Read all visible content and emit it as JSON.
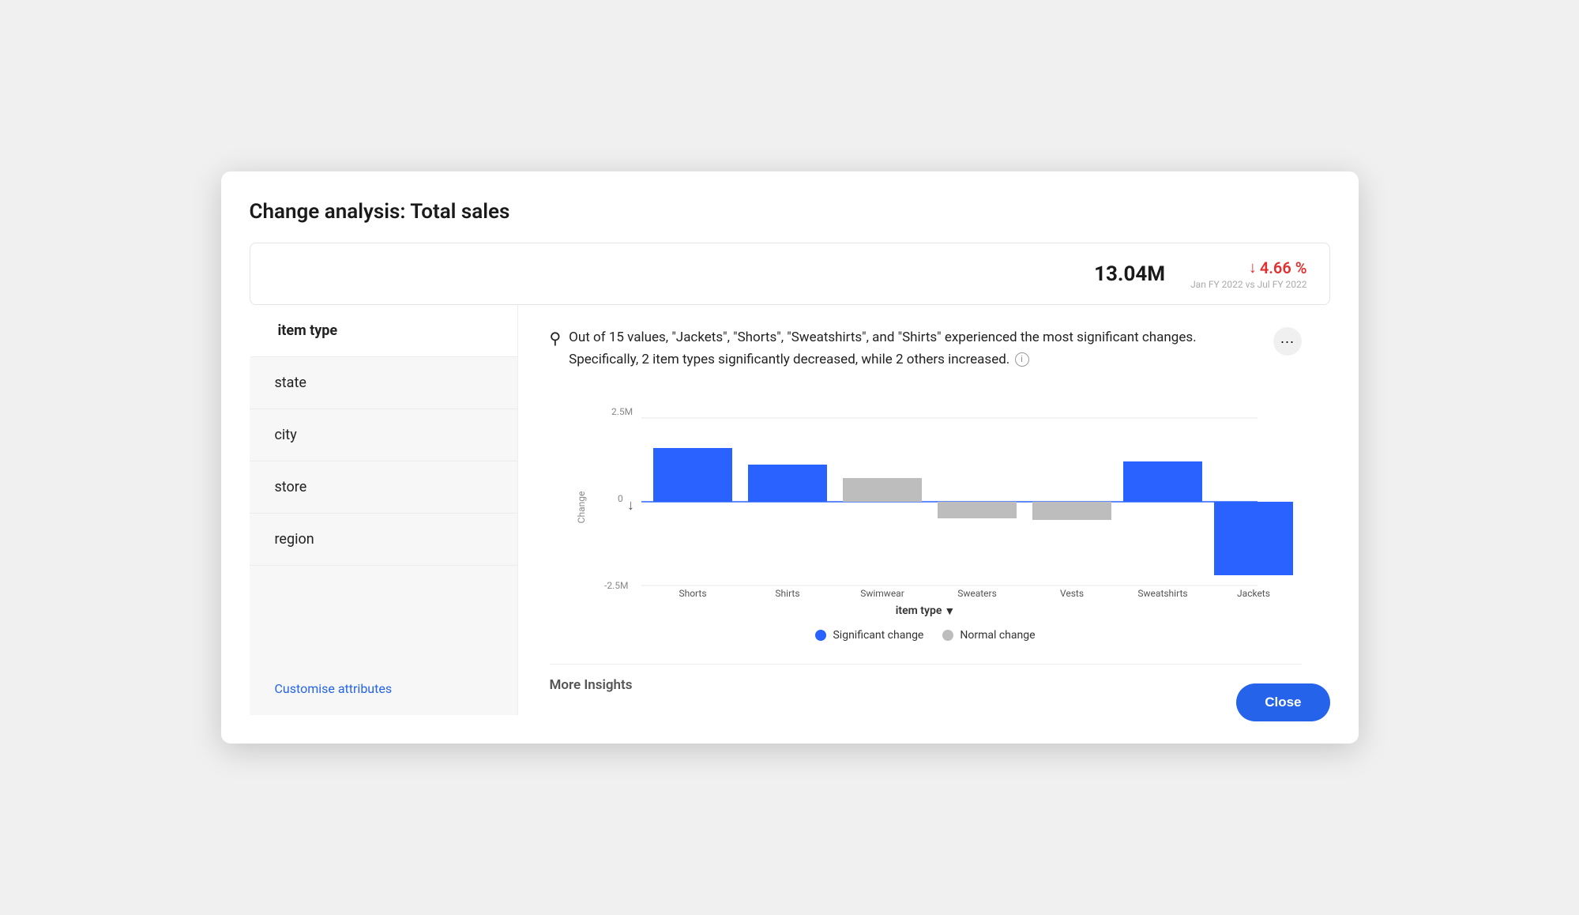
{
  "page": {
    "title": "Change analysis: Total sales"
  },
  "metric": {
    "value": "13.04M",
    "change_pct": "4.66 %",
    "change_direction": "↓",
    "period": "Jan FY 2022 vs Jul FY 2022"
  },
  "sidebar": {
    "items": [
      {
        "id": "item-type",
        "label": "item type",
        "active": true
      },
      {
        "id": "state",
        "label": "state",
        "active": false
      },
      {
        "id": "city",
        "label": "city",
        "active": false
      },
      {
        "id": "store",
        "label": "store",
        "active": false
      },
      {
        "id": "region",
        "label": "region",
        "active": false
      }
    ],
    "customise_label": "Customise attributes"
  },
  "insight": {
    "text_prefix": "Out of 15 values, \"Jackets\", \"Shorts\", \"Sweatshirts\", and \"Shirts\" experienced the most significant changes. Specifically, 2 item types significantly decreased, while 2 others increased.",
    "more_btn_label": "···"
  },
  "chart": {
    "y_labels": [
      "2.5M",
      "0",
      "-2.5M"
    ],
    "x_label": "item type",
    "bars": [
      {
        "label": "Shorts",
        "value": 1.6,
        "significant": true
      },
      {
        "label": "Shirts",
        "value": 1.1,
        "significant": true
      },
      {
        "label": "Swimwear",
        "value": 0.7,
        "significant": false
      },
      {
        "label": "Sweaters",
        "value": -0.5,
        "significant": false
      },
      {
        "label": "Vests",
        "value": -0.55,
        "significant": false
      },
      {
        "label": "Sweatshirts",
        "value": 1.2,
        "significant": true
      },
      {
        "label": "Jackets",
        "value": -2.2,
        "significant": true
      }
    ],
    "y_max": 2.5,
    "y_min": -2.5,
    "legend": [
      {
        "label": "Significant change",
        "color": "#2962ff"
      },
      {
        "label": "Normal change",
        "color": "#bdbdbd"
      }
    ]
  },
  "footer": {
    "more_insights_label": "More Insights",
    "close_label": "Close"
  }
}
